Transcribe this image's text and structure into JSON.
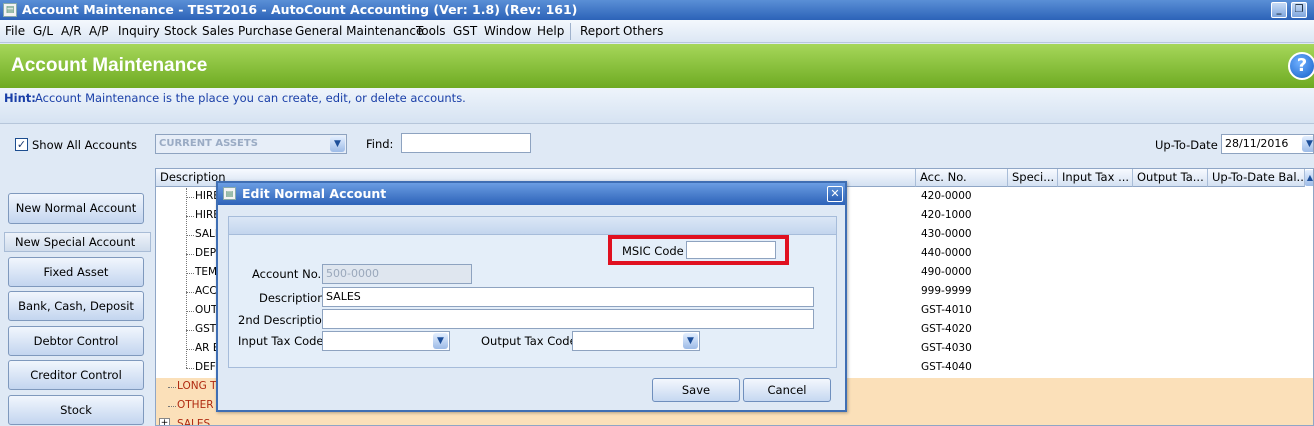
{
  "window": {
    "title": "Account Maintenance - TEST2016 - AutoCount Accounting (Ver: 1.8) (Rev: 161)",
    "app_icon": "document-icon",
    "minimize": "_",
    "restore": "❐"
  },
  "menu": {
    "items": [
      "File",
      "G/L",
      "A/R",
      "A/P",
      "Inquiry",
      "Stock",
      "Sales",
      "Purchase",
      "General Maintenance",
      "Tools",
      "GST",
      "Window",
      "Help",
      "Report",
      "Others"
    ]
  },
  "header": {
    "title": "Account Maintenance",
    "help_glyph": "?"
  },
  "hint": {
    "label": "Hint:",
    "text": "Account Maintenance is the place you can create, edit, or delete accounts."
  },
  "filters": {
    "show_all_label": "Show All Accounts",
    "show_all_checked": true,
    "account_type_value": "CURRENT ASSETS",
    "find_label": "Find:",
    "find_value": "",
    "up_to_date_label": "Up-To-Date",
    "up_to_date_value": "28/11/2016"
  },
  "left_panel": {
    "new_normal_account": "New Normal Account",
    "new_special_account_header": "New Special Account",
    "special_buttons": [
      "Fixed Asset",
      "Bank, Cash, Deposit",
      "Debtor Control",
      "Creditor Control",
      "Stock"
    ]
  },
  "grid": {
    "columns": [
      "Description",
      "Acc. No.",
      "Speci...",
      "Input Tax ...",
      "Output Ta...",
      "Up-To-Date Bal..."
    ],
    "rows": [
      {
        "desc": "HIRE",
        "acc": "420-0000"
      },
      {
        "desc": "HIRE",
        "acc": "420-1000"
      },
      {
        "desc": "SALE",
        "acc": "430-0000"
      },
      {
        "desc": "DEPO",
        "acc": "440-0000"
      },
      {
        "desc": "TEM",
        "acc": "490-0000"
      },
      {
        "desc": "ACC",
        "acc": "999-9999"
      },
      {
        "desc": "OUT",
        "acc": "GST-4010"
      },
      {
        "desc": "GST",
        "acc": "GST-4020"
      },
      {
        "desc": "AR E",
        "acc": "GST-4030"
      },
      {
        "desc": "DEFE",
        "acc": "GST-4040"
      }
    ],
    "group_rows": [
      {
        "desc": "LONG TE"
      },
      {
        "desc": "OTHER I"
      },
      {
        "desc": "SALES"
      }
    ]
  },
  "dialog": {
    "title": "Edit Normal Account",
    "msic_label": "MSIC Code",
    "msic_value": "",
    "account_no_label": "Account No.",
    "account_no_value": "500-0000",
    "description_label": "Description",
    "description_value": "SALES",
    "second_description_label": "2nd Description",
    "second_description_value": "",
    "input_tax_label": "Input Tax Code",
    "input_tax_value": "",
    "output_tax_label": "Output Tax Code",
    "output_tax_value": "",
    "save_label": "Save",
    "cancel_label": "Cancel"
  },
  "colors": {
    "header_green": "#7ab833",
    "title_blue": "#2c63b8",
    "highlight_red": "#e01020",
    "group_row_bg": "#fbe0b9"
  }
}
